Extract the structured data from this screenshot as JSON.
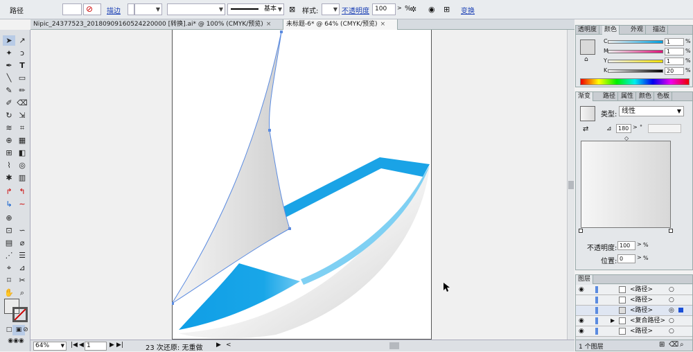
{
  "control_bar": {
    "object_type": "路径",
    "stroke_label": "描边",
    "stroke_profile": "基本",
    "style_label": "样式:",
    "opacity_label": "不透明度",
    "opacity_value": "100",
    "opacity_unit": "%",
    "transform_label": "变换"
  },
  "tabs": [
    {
      "label": "Nipic_24377523_20180909160524220000 [转换].ai* @ 100% (CMYK/预览)",
      "close": "×"
    },
    {
      "label": "未标题-6* @ 64% (CMYK/预览)",
      "close": "×"
    }
  ],
  "status": {
    "zoom": "64%",
    "page": "1",
    "history": "23 次还原: 无重做"
  },
  "color_panel": {
    "tabs": [
      "透明度",
      "颜色",
      "外观",
      "描边"
    ],
    "active_tab": "颜色",
    "channels": [
      {
        "name": "C",
        "value": "1",
        "unit": "%"
      },
      {
        "name": "M",
        "value": "1",
        "unit": "%"
      },
      {
        "name": "Y",
        "value": "1",
        "unit": "%"
      },
      {
        "name": "K",
        "value": "20",
        "unit": "%"
      }
    ]
  },
  "gradient_panel": {
    "tabs": [
      "渐变",
      "路径",
      "属性",
      "颜色",
      "色板"
    ],
    "active_tab": "渐变",
    "type_label": "类型:",
    "type_value": "线性",
    "angle_value": "180",
    "angle_unit": "°",
    "opacity_label": "不透明度:",
    "opacity_value": "100",
    "opacity_unit": "%",
    "location_label": "位置:",
    "location_value": "0",
    "location_unit": "%"
  },
  "layers_panel": {
    "title": "图层",
    "rows": [
      "<路径>",
      "<路径>",
      "<路径>",
      "<复合路径>",
      "<路径>"
    ],
    "footer": "1 个图层"
  },
  "colors": {
    "accent_blue": "#1aa3e6",
    "sail_gray": "#d9d9d9",
    "selection_blue": "#5b8be0"
  }
}
